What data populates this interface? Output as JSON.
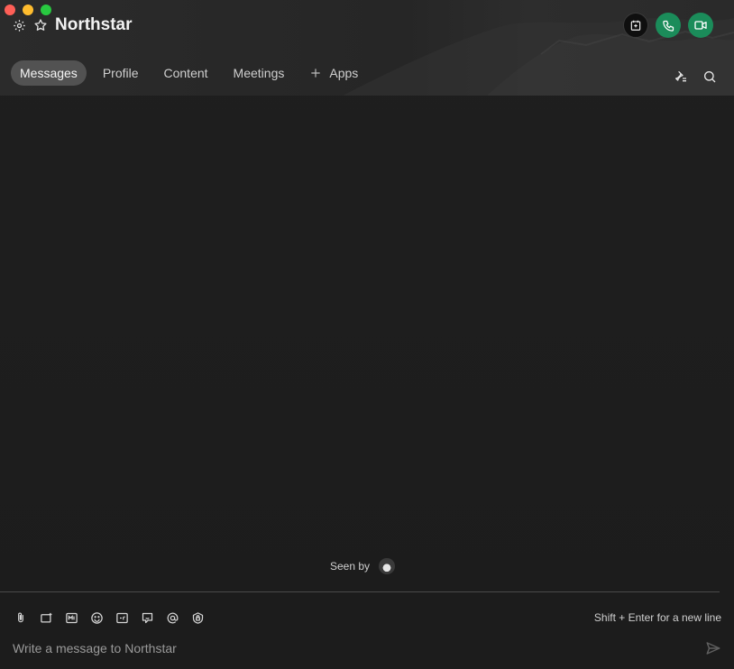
{
  "window": {
    "title": "Northstar"
  },
  "header": {
    "settings_icon": "gear-icon",
    "favorite_icon": "star-icon",
    "actions": [
      {
        "name": "schedule-meeting-button",
        "icon": "calendar-icon"
      },
      {
        "name": "audio-call-button",
        "icon": "phone-icon"
      },
      {
        "name": "video-call-button",
        "icon": "video-icon"
      }
    ]
  },
  "tabs": [
    {
      "label": "Messages",
      "active": true
    },
    {
      "label": "Profile",
      "active": false
    },
    {
      "label": "Content",
      "active": false
    },
    {
      "label": "Meetings",
      "active": false
    },
    {
      "label": "Apps",
      "active": false,
      "icon": "plus-icon"
    }
  ],
  "header_right": {
    "pinned_icon": "pin-list-icon",
    "search_icon": "search-icon"
  },
  "conversation": {
    "seen_by_label": "Seen by"
  },
  "composer": {
    "tools": [
      "attachment-icon",
      "screenshot-icon",
      "markdown-icon",
      "emoji-icon",
      "gif-icon",
      "sticker-icon",
      "mention-icon",
      "secure-message-icon"
    ],
    "hint": "Shift + Enter for a new line",
    "placeholder": "Write a message to Northstar"
  },
  "colors": {
    "accent_green": "#1b8c5a",
    "active_tab": "#525252",
    "background": "#1c1c1c"
  }
}
